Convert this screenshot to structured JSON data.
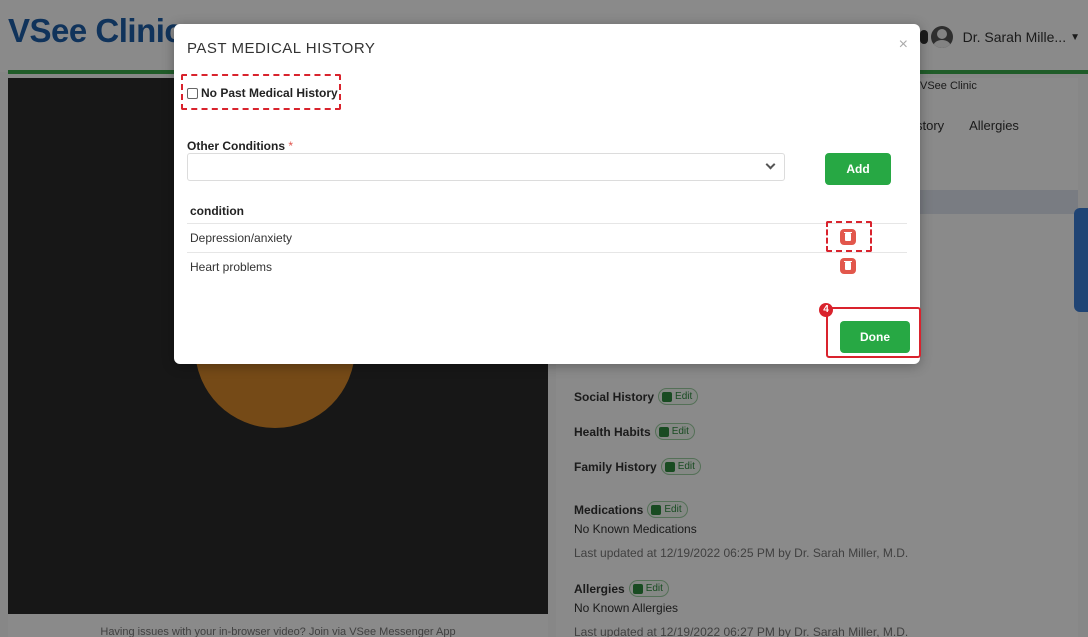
{
  "app": {
    "logo": "VSee Clinic",
    "user_name": "Dr. Sarah Mille...",
    "clinic_label": "VSee Clinic",
    "tabs": [
      "story",
      "Allergies"
    ],
    "video_note": "Having issues with your in-browser video? Join via VSee Messenger App"
  },
  "sections": {
    "social_history": "Social History",
    "health_habits": "Health Habits",
    "family_history": "Family History",
    "medications": "Medications",
    "medications_value": "No Known Medications",
    "medications_updated": "Last updated at 12/19/2022 06:25 PM by Dr. Sarah Miller, M.D.",
    "allergies": "Allergies",
    "allergies_value": "No Known Allergies",
    "allergies_updated": "Last updated at 12/19/2022 06:27 PM by Dr. Sarah Miller, M.D.",
    "edit_label": "Edit"
  },
  "modal": {
    "title": "PAST MEDICAL HISTORY",
    "close_icon": "×",
    "no_history_label": "No Past Medical History",
    "no_history_checked": false,
    "other_conditions_label": "Other Conditions",
    "required_mark": "*",
    "select_value": "",
    "add_label": "Add",
    "table_header": "condition",
    "conditions": [
      "Depression/anxiety",
      "Heart problems"
    ],
    "done_label": "Done",
    "step_number": "4"
  },
  "colors": {
    "primary_green": "#27a844",
    "delete_red": "#e2574c",
    "highlight_red": "#d9232d",
    "brand_blue": "#1f5fa8"
  }
}
